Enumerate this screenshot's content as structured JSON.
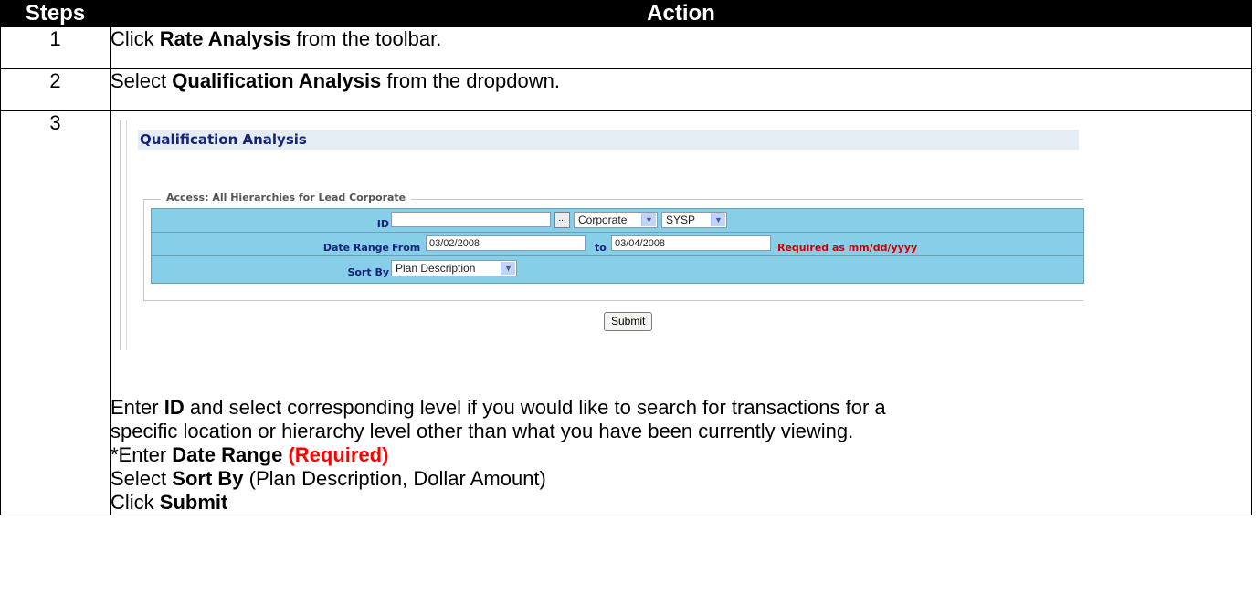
{
  "header": {
    "steps": "Steps",
    "action": "Action"
  },
  "step1": {
    "num": "1",
    "pre": "Click ",
    "bold": "Rate Analysis",
    "post": " from the toolbar."
  },
  "step2": {
    "num": "2",
    "pre": "Select ",
    "bold": "Qualification Analysis",
    "post": " from the dropdown."
  },
  "step3": {
    "num": "3",
    "screenshot": {
      "title": "Qualification Analysis",
      "legend": "Access: All Hierarchies for Lead Corporate",
      "id_label": "ID",
      "id_value": "",
      "dots_button": "...",
      "level_select": "Corporate",
      "sysp_select": "SYSP",
      "date_range_label": "Date Range",
      "from_label": "From",
      "from_value": "03/02/2008",
      "to_label": "to",
      "to_value": "03/04/2008",
      "required_note": "Required as mm/dd/yyyy",
      "sort_by_label": "Sort By",
      "sort_by_value": "Plan Description",
      "submit": "Submit"
    },
    "line1_a": "Enter ",
    "line1_b": "ID",
    "line1_c": " and select corresponding level if you would like to search for transactions for a",
    "line2": "specific location or hierarchy level other than what you have been currently viewing.",
    "line3_a": "*Enter ",
    "line3_b": "Date Range",
    "line3_c": "(Required)",
    "line4_a": "Select ",
    "line4_b": "Sort By",
    "line4_c": " (Plan Description, Dollar Amount)",
    "line5_a": "Click ",
    "line5_b": "Submit"
  }
}
